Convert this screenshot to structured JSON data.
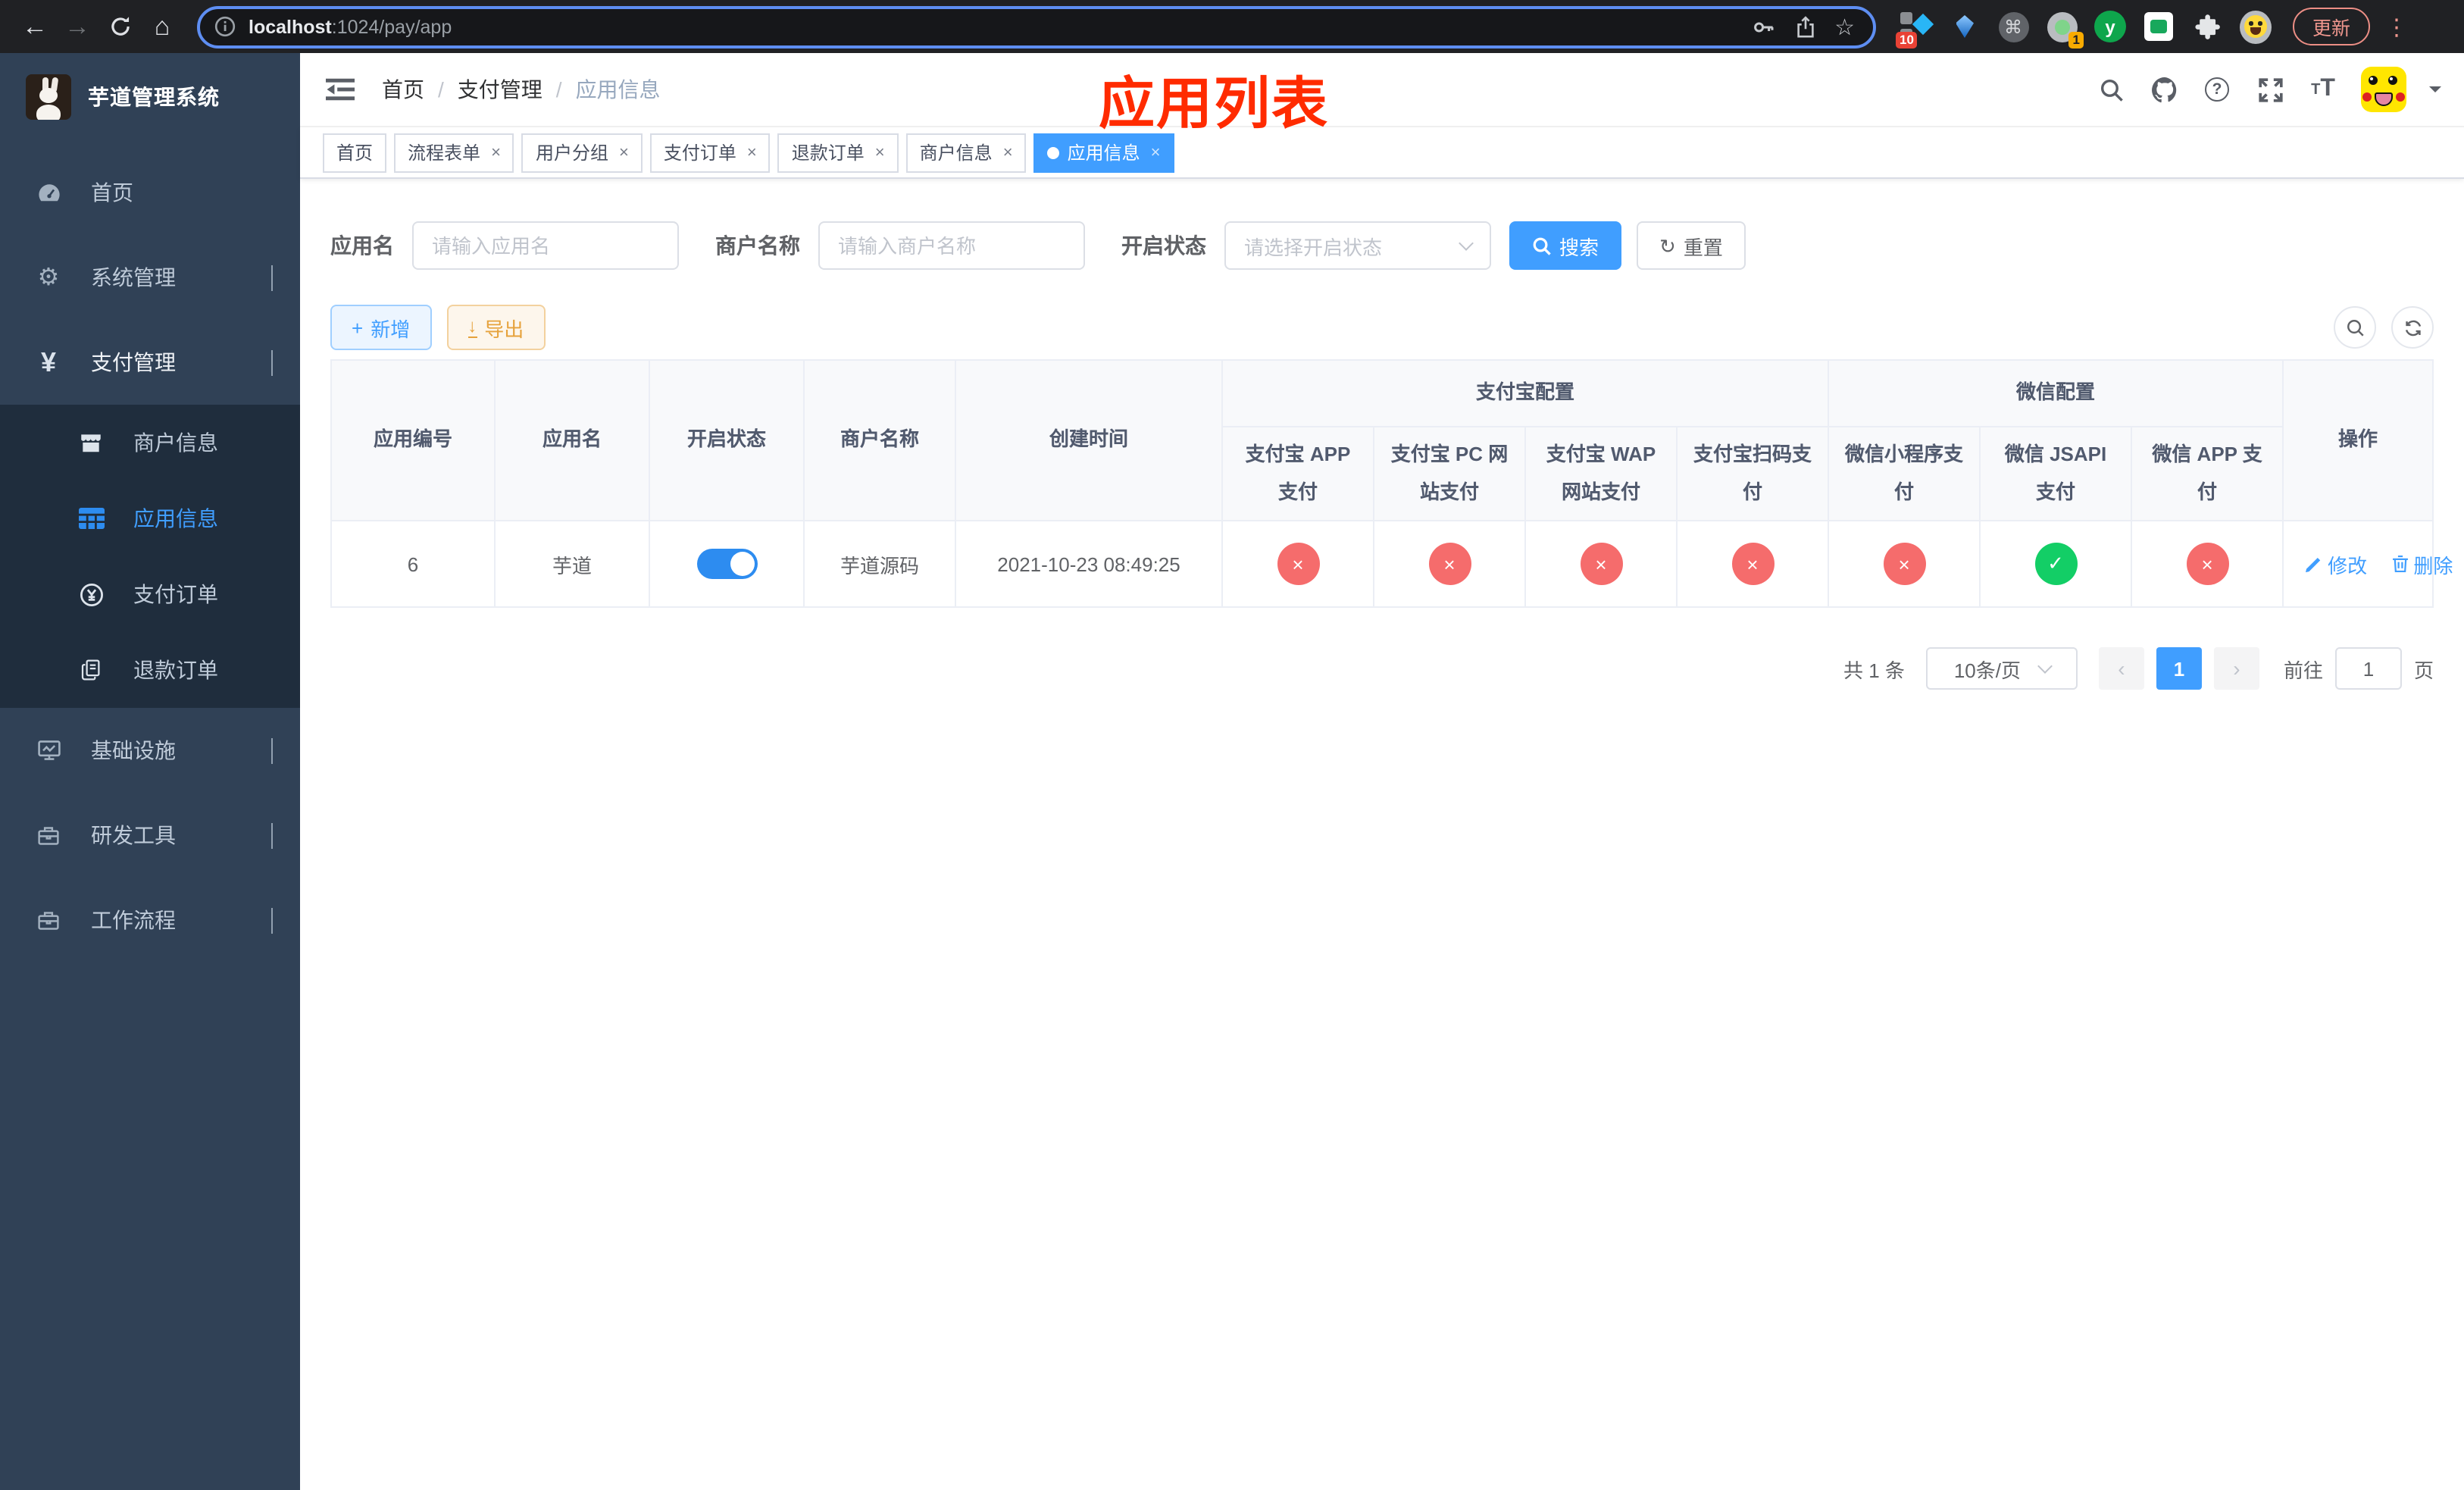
{
  "browser": {
    "url_host": "localhost",
    "url_path": ":1024/pay/app",
    "update_label": "更新",
    "ext_badge_blue_diamond": "10",
    "ext_badge_camera": "1",
    "ext_y_label": "y"
  },
  "sidebar": {
    "title": "芋道管理系统",
    "items": [
      {
        "label": "首页"
      },
      {
        "label": "系统管理"
      },
      {
        "label": "支付管理"
      },
      {
        "label": "商户信息"
      },
      {
        "label": "应用信息",
        "active": true
      },
      {
        "label": "支付订单"
      },
      {
        "label": "退款订单"
      },
      {
        "label": "基础设施"
      },
      {
        "label": "研发工具"
      },
      {
        "label": "工作流程"
      }
    ]
  },
  "navbar": {
    "breadcrumb": [
      "首页",
      "支付管理",
      "应用信息"
    ],
    "annotation": "应用列表"
  },
  "tabs": [
    {
      "label": "首页",
      "active": false
    },
    {
      "label": "流程表单",
      "active": false
    },
    {
      "label": "用户分组",
      "active": false
    },
    {
      "label": "支付订单",
      "active": false
    },
    {
      "label": "退款订单",
      "active": false
    },
    {
      "label": "商户信息",
      "active": false
    },
    {
      "label": "应用信息",
      "active": true
    }
  ],
  "filters": {
    "app_name_label": "应用名",
    "app_name_placeholder": "请输入应用名",
    "merchant_label": "商户名称",
    "merchant_placeholder": "请输入商户名称",
    "status_label": "开启状态",
    "status_placeholder": "请选择开启状态",
    "search_label": "搜索",
    "reset_label": "重置"
  },
  "toolbar": {
    "add_label": "新增",
    "export_label": "导出"
  },
  "table": {
    "groups": {
      "alipay": "支付宝配置",
      "wechat": "微信配置"
    },
    "columns": [
      "应用编号",
      "应用名",
      "开启状态",
      "商户名称",
      "创建时间",
      "支付宝 APP 支付",
      "支付宝 PC 网站支付",
      "支付宝 WAP 网站支付",
      "支付宝扫码支付",
      "微信小程序支付",
      "微信 JSAPI 支付",
      "微信 APP 支付",
      "操作"
    ],
    "rows": [
      {
        "id": "6",
        "name": "芋道",
        "enabled": true,
        "merchant": "芋道源码",
        "created": "2021-10-23 08:49:25",
        "channels": [
          false,
          false,
          false,
          false,
          false,
          true,
          false
        ],
        "edit_label": "修改",
        "delete_label": "删除"
      }
    ]
  },
  "pagination": {
    "total": "共 1 条",
    "page_size": "10条/页",
    "page": "1",
    "goto_label": "前往",
    "goto_value": "1",
    "page_unit": "页"
  },
  "icons": {
    "ok_glyph": "✓",
    "fail_glyph": "×"
  },
  "colors": {
    "primary": "#409eff",
    "success": "#13ce66",
    "danger": "#f56c6c",
    "warning": "#e6a23c",
    "annotation": "#ff2b00"
  }
}
